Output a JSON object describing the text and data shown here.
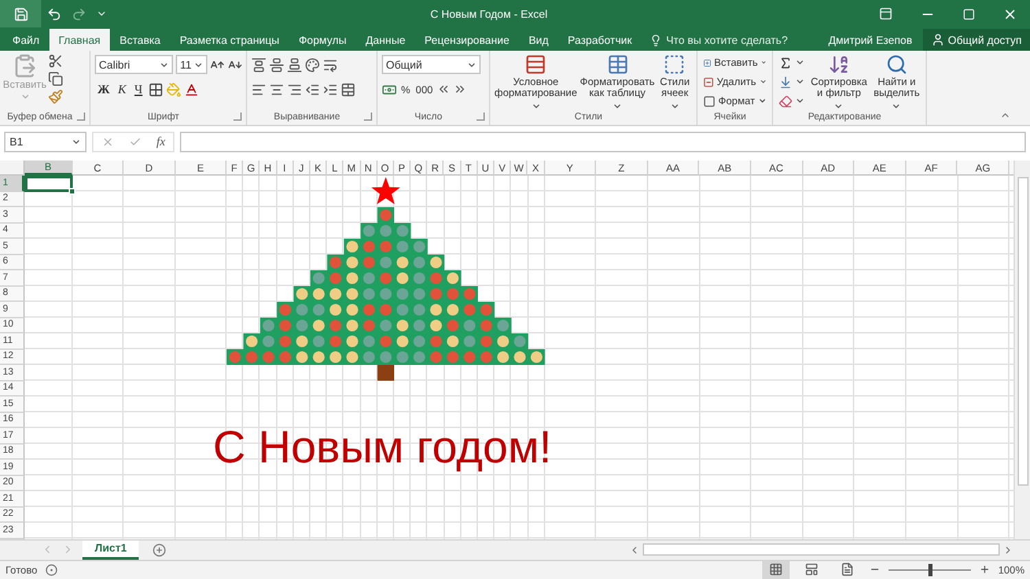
{
  "window": {
    "title": "С Новым Годом - Excel"
  },
  "tabs": [
    {
      "label": "Файл",
      "selected": false
    },
    {
      "label": "Главная",
      "selected": true
    },
    {
      "label": "Вставка",
      "selected": false
    },
    {
      "label": "Разметка страницы",
      "selected": false
    },
    {
      "label": "Формулы",
      "selected": false
    },
    {
      "label": "Данные",
      "selected": false
    },
    {
      "label": "Рецензирование",
      "selected": false
    },
    {
      "label": "Вид",
      "selected": false
    },
    {
      "label": "Разработчик",
      "selected": false
    }
  ],
  "tell_me": {
    "placeholder": "Что вы хотите сделать?"
  },
  "user": "Дмитрий Езепов",
  "share": "Общий доступ",
  "ribbon": {
    "clipboard": {
      "label": "Буфер обмена",
      "paste": "Вставить"
    },
    "font": {
      "label": "Шрифт",
      "font_name": "Calibri",
      "font_size": "11",
      "bold": "Ж",
      "italic": "К",
      "underline": "Ч"
    },
    "alignment": {
      "label": "Выравнивание"
    },
    "number": {
      "label": "Число",
      "format": "Общий",
      "percent": "%",
      "thousands": "000"
    },
    "styles": {
      "label": "Стили",
      "buttons": [
        {
          "lines": [
            "Условное",
            "форматирование"
          ]
        },
        {
          "lines": [
            "Форматировать",
            "как таблицу"
          ]
        },
        {
          "lines": [
            "Стили",
            "ячеек"
          ]
        }
      ]
    },
    "cells": {
      "label": "Ячейки",
      "buttons": [
        "Вставить",
        "Удалить",
        "Формат"
      ]
    },
    "editing": {
      "label": "Редактирование",
      "buttons": [
        {
          "lines": [
            "Сортировка",
            "и фильтр"
          ]
        },
        {
          "lines": [
            "Найти и",
            "выделить"
          ]
        }
      ]
    }
  },
  "formula_bar": {
    "name_box": "B1",
    "function_label": "fx"
  },
  "columns": [
    {
      "label": "B",
      "selected": true
    },
    {
      "label": "C",
      "selected": false
    },
    {
      "label": "D",
      "selected": false
    },
    {
      "label": "E",
      "selected": false
    },
    {
      "label": "F",
      "selected": false
    },
    {
      "label": "G",
      "selected": false
    },
    {
      "label": "H",
      "selected": false
    },
    {
      "label": "I",
      "selected": false
    },
    {
      "label": "J",
      "selected": false
    },
    {
      "label": "K",
      "selected": false
    },
    {
      "label": "L",
      "selected": false
    },
    {
      "label": "M",
      "selected": false
    },
    {
      "label": "N",
      "selected": false
    },
    {
      "label": "O",
      "selected": false
    },
    {
      "label": "P",
      "selected": false
    },
    {
      "label": "Q",
      "selected": false
    },
    {
      "label": "R",
      "selected": false
    },
    {
      "label": "S",
      "selected": false
    },
    {
      "label": "T",
      "selected": false
    },
    {
      "label": "U",
      "selected": false
    },
    {
      "label": "V",
      "selected": false
    },
    {
      "label": "W",
      "selected": false
    },
    {
      "label": "X",
      "selected": false
    },
    {
      "label": "Y",
      "selected": false
    },
    {
      "label": "Z",
      "selected": false
    },
    {
      "label": "AA",
      "selected": false
    },
    {
      "label": "AB",
      "selected": false
    },
    {
      "label": "AC",
      "selected": false
    },
    {
      "label": "AD",
      "selected": false
    },
    {
      "label": "AE",
      "selected": false
    },
    {
      "label": "AF",
      "selected": false
    },
    {
      "label": "AG",
      "selected": false
    }
  ],
  "rows": [
    {
      "label": "1",
      "selected": true
    },
    {
      "label": "2",
      "selected": false
    },
    {
      "label": "3",
      "selected": false
    },
    {
      "label": "4",
      "selected": false
    },
    {
      "label": "5",
      "selected": false
    },
    {
      "label": "6",
      "selected": false
    },
    {
      "label": "7",
      "selected": false
    },
    {
      "label": "8",
      "selected": false
    },
    {
      "label": "9",
      "selected": false
    },
    {
      "label": "10",
      "selected": false
    },
    {
      "label": "11",
      "selected": false
    },
    {
      "label": "12",
      "selected": false
    },
    {
      "label": "13",
      "selected": false
    },
    {
      "label": "14",
      "selected": false
    },
    {
      "label": "15",
      "selected": false
    },
    {
      "label": "16",
      "selected": false
    },
    {
      "label": "17",
      "selected": false
    },
    {
      "label": "18",
      "selected": false
    },
    {
      "label": "19",
      "selected": false
    },
    {
      "label": "20",
      "selected": false
    },
    {
      "label": "21",
      "selected": false
    },
    {
      "label": "22",
      "selected": false
    },
    {
      "label": "23",
      "selected": false
    }
  ],
  "greeting": "С Новым годом!",
  "sheets": [
    {
      "label": "Лист1",
      "selected": true
    }
  ],
  "status_bar": {
    "status": "Готово",
    "zoom": {
      "level": 0.5,
      "reading": "100%"
    }
  }
}
